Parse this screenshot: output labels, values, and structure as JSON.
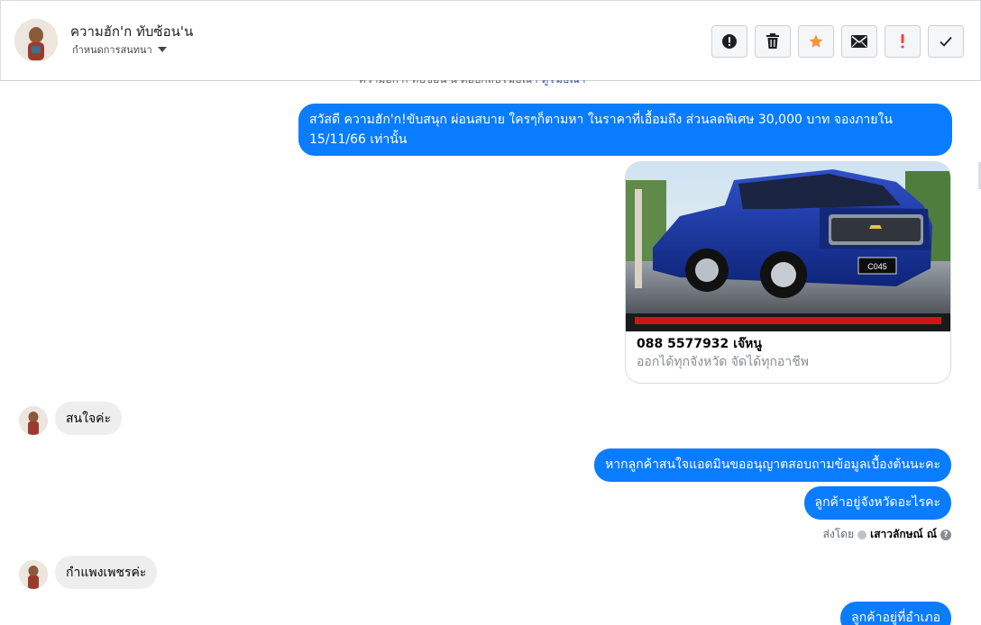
{
  "header": {
    "name": "ความฮัก'ก ทับซ้อน'น",
    "sub_label": "กำหนดการสนทนา"
  },
  "actions": [
    {
      "name": "report-icon",
      "symbol": "!"
    },
    {
      "name": "trash-icon",
      "symbol": ""
    },
    {
      "name": "star-icon",
      "symbol": "★"
    },
    {
      "name": "mail-icon",
      "symbol": "✉"
    },
    {
      "name": "spam-icon",
      "symbol": "!"
    },
    {
      "name": "check-icon",
      "symbol": "✓"
    }
  ],
  "partial_notice": {
    "text": "ความฮัก'ก ทับซ้อน'น ตอบกลับโฆษณา",
    "link": "ดูโฆษณา"
  },
  "messages": {
    "m1": "สวัสดี ความฮัก'ก!ขับสนุก ผ่อนสบาย ใครๆก็ตามหา ในราคาที่เอื้อมถึง ส่วนลดพิเศษ 30,000 บาท จองภายใน 15/11/66 เท่านั้น",
    "card_title": "088 5577932 เจ๊หนู",
    "card_desc": "ออกได้ทุกจังหวัด จัดได้ทุกอาชีพ",
    "card_plate": "C045",
    "in1": "สนใจค่ะ",
    "out2": "หากลูกค้าสนใจแอดมินขออนุญาตสอบถามข้อมูลเบื้องต้นนะคะ",
    "out3": "ลูกค้าอยู่จังหวัดอะไรคะ",
    "sent_by_prefix": "ส่งโดย",
    "sent_by_name": "เสาวลักษณ์ ณ์",
    "in2": "กำแพงเพชรค่ะ",
    "out4_partial": "ลูกค้าอยู่ที่อำเภอ"
  },
  "colors": {
    "outgoing": "#0a7cff",
    "incoming": "#eeeeee",
    "star": "#f7923a",
    "spam": "#fa3e3e"
  }
}
